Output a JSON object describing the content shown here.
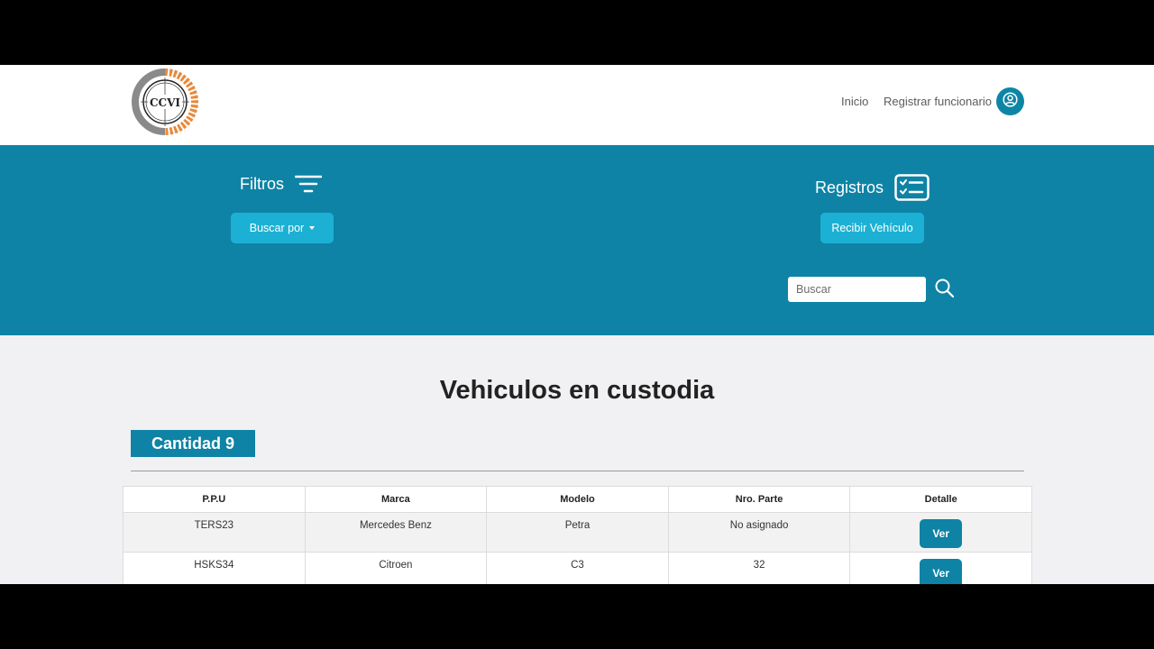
{
  "navbar": {
    "logo_text": "CCVI",
    "links": [
      {
        "label": "Inicio"
      },
      {
        "label": "Registrar funcionario"
      }
    ]
  },
  "band": {
    "filtros": {
      "heading": "Filtros",
      "button_label": "Buscar por"
    },
    "registros": {
      "heading": "Registros",
      "button_label": "Recibir Vehículo"
    },
    "search": {
      "placeholder": "Buscar"
    }
  },
  "main": {
    "title": "Vehiculos en custodia",
    "count_label": "Cantidad 9",
    "table": {
      "headers": [
        "P.P.U",
        "Marca",
        "Modelo",
        "Nro. Parte",
        "Detalle"
      ],
      "rows": [
        {
          "ppu": "TERS23",
          "marca": "Mercedes Benz",
          "modelo": "Petra",
          "nro_parte": "No asignado",
          "action_label": "Ver"
        },
        {
          "ppu": "HSKS34",
          "marca": "Citroen",
          "modelo": "C3",
          "nro_parte": "32",
          "action_label": "Ver"
        }
      ]
    }
  },
  "colors": {
    "primary": "#0e83a5",
    "button_light": "#1cb1d4",
    "background": "#f1f0f2"
  }
}
